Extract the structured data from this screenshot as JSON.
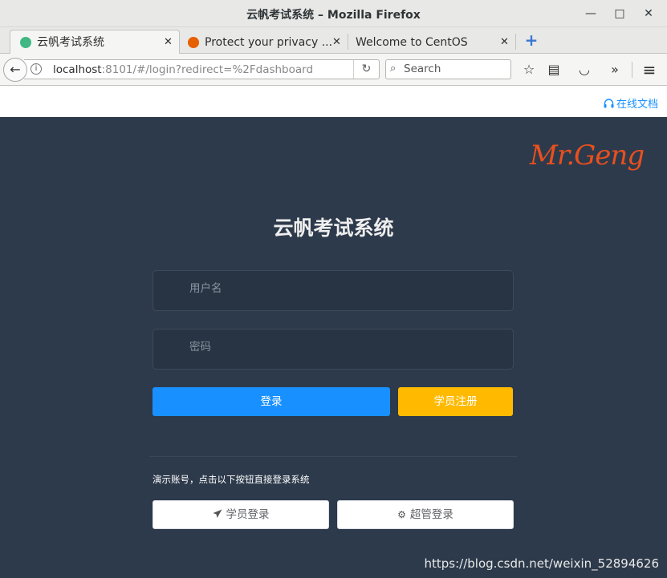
{
  "window": {
    "title": "云帆考试系统 – Mozilla Firefox",
    "controls": {
      "minimize": "—",
      "maximize": "□",
      "close": "✕"
    }
  },
  "tabs": [
    {
      "label": "云帆考试系统",
      "close": "✕",
      "active": true,
      "favicon_color": "#41b883"
    },
    {
      "label": "Protect your privacy ...",
      "close": "✕",
      "active": false,
      "favicon_color": "#e66000"
    },
    {
      "label": "Welcome to CentOS",
      "close": "✕",
      "active": false
    }
  ],
  "new_tab": "+",
  "navbar": {
    "back": "←",
    "url_host": "localhost",
    "url_rest": ":8101/#/login?redirect=%2Fdashboard",
    "reload": "↻",
    "search_placeholder": "Search",
    "tools": {
      "bookmark": "☆",
      "reader": "▤",
      "pocket": "◡",
      "overflow": "»",
      "menu": "≡"
    }
  },
  "page": {
    "doc_link": "在线文档",
    "signature": "Mr.Geng",
    "title": "云帆考试系统",
    "username_placeholder": "用户名",
    "password_placeholder": "密码",
    "login_button": "登录",
    "register_button": "学员注册",
    "demo_tip": "演示账号，点击以下按钮直接登录系统",
    "student_login": "学员登录",
    "admin_login": "超管登录",
    "watermark": "https://blog.csdn.net/weixin_52894626"
  },
  "colors": {
    "login_bg": "#2d3a4b",
    "primary": "#1890ff",
    "warning": "#ffba00",
    "signature": "#e8501e"
  }
}
